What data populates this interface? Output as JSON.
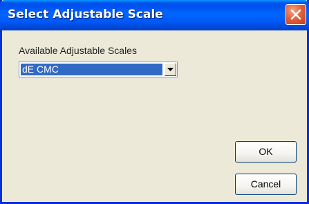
{
  "window": {
    "title": "Select Adjustable Scale",
    "close_icon": "close-icon"
  },
  "form": {
    "label": "Available Adjustable Scales",
    "selected_scale": "dE CMC",
    "dropdown_icon": "chevron-down-icon"
  },
  "buttons": {
    "ok_label": "OK",
    "cancel_label": "Cancel"
  },
  "colors": {
    "title_bar": "#0055ea",
    "close_button": "#e2623b",
    "selection": "#316ac5",
    "dialog_background": "#ece9d8"
  }
}
